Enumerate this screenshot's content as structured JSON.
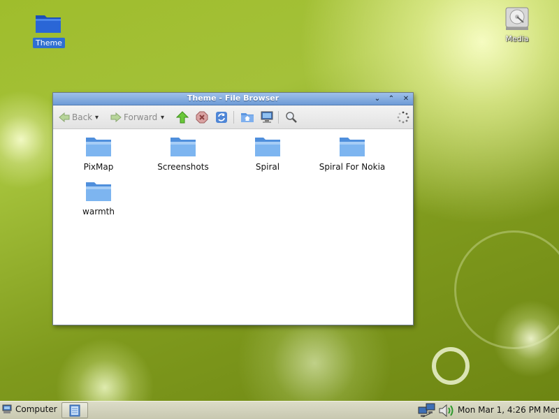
{
  "desktop": {
    "icons": [
      {
        "label": "Theme",
        "icon": "folder-icon",
        "selected": true
      },
      {
        "label": "Media",
        "icon": "hard-disk-icon"
      }
    ]
  },
  "window": {
    "title": "Theme - File Browser",
    "controls": {
      "minimize": "⌄",
      "maximize": "⌃",
      "close": "✕"
    },
    "toolbar": {
      "back_label": "Back",
      "forward_label": "Forward",
      "back_dropdown": "▾",
      "forward_dropdown": "▾"
    },
    "folders": [
      {
        "name": "PixMap"
      },
      {
        "name": "Screenshots"
      },
      {
        "name": "Spiral"
      },
      {
        "name": "Spiral For Nokia"
      },
      {
        "name": "warmth"
      }
    ]
  },
  "taskbar": {
    "start_label": "Computer",
    "clock": "Mon Mar  1,  4:26 PM",
    "menu_label": "Menu"
  },
  "colors": {
    "titlebar": "#7aa6dc",
    "folder_blue": "#6aa6e8",
    "selection": "#2f6fd1",
    "taskbar": "#d4d4be"
  }
}
